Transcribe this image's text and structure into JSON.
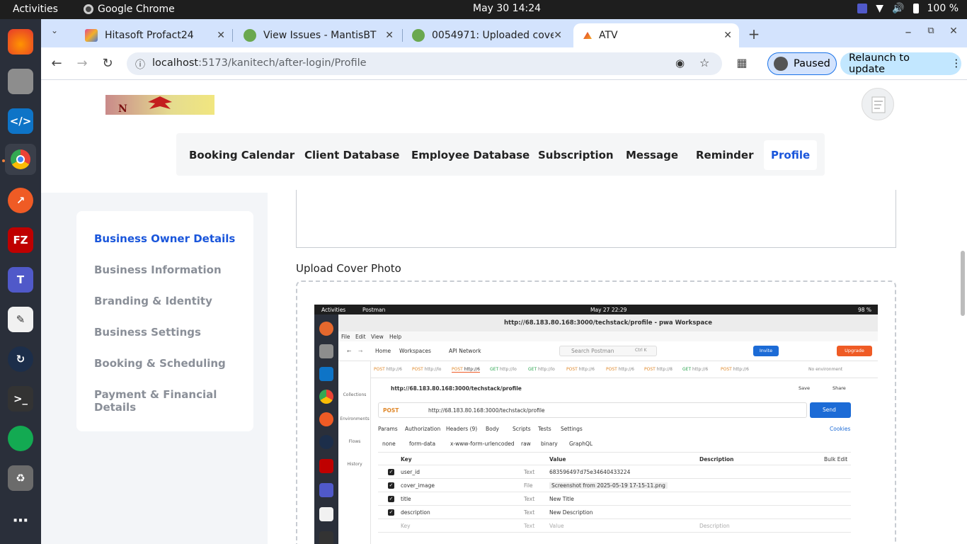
{
  "system_bar": {
    "activities": "Activities",
    "app_name": "Google Chrome",
    "clock": "May 30  14:24",
    "battery": "100 %"
  },
  "tabs": [
    {
      "title": "Hitasoft Profact24"
    },
    {
      "title": "View Issues - MantisBT"
    },
    {
      "title": "0054971: Uploaded cove"
    },
    {
      "title": "ATV"
    }
  ],
  "address_bar": {
    "host": "localhost",
    "path": ":5173/kanitech/after-login/Profile"
  },
  "profile_chip": "Paused",
  "relaunch_label": "Relaunch to update",
  "nav": {
    "items": [
      "Booking Calendar",
      "Client Database",
      "Employee Database",
      "Subscription",
      "Message",
      "Reminder",
      "Profile"
    ],
    "active": "Profile"
  },
  "sidebar": {
    "items": [
      "Business Owner Details",
      "Business Information",
      "Branding & Identity",
      "Business Settings",
      "Booking & Scheduling",
      "Payment & Financial Details"
    ],
    "active": "Business Owner Details"
  },
  "upload_label": "Upload Cover Photo",
  "preview": {
    "activities": "Activities",
    "app": "Postman",
    "clock": "May 27  22:29",
    "battery": "98 %",
    "window_title": "http://68.183.80.168:3000/techstack/profile - pwa Workspace",
    "menu": [
      "File",
      "Edit",
      "View",
      "Help"
    ],
    "home": "Home",
    "workspaces": "Workspaces",
    "api_network": "API Network",
    "search_placeholder": "Search Postman",
    "search_shortcut": "Ctrl K",
    "invite": "Invite",
    "upgrade": "Upgrade",
    "request_tabs": [
      {
        "method": "POST",
        "label": "http://6"
      },
      {
        "method": "POST",
        "label": "http://lo"
      },
      {
        "method": "POST",
        "label": "http://6"
      },
      {
        "method": "GET",
        "label": "http://lo"
      },
      {
        "method": "GET",
        "label": "http://lo"
      },
      {
        "method": "POST",
        "label": "http://6"
      },
      {
        "method": "POST",
        "label": "http://6"
      },
      {
        "method": "POST",
        "label": "http://8"
      },
      {
        "method": "GET",
        "label": "http://6"
      },
      {
        "method": "POST",
        "label": "http://6"
      }
    ],
    "no_environment": "No environment",
    "side_items": [
      "Collections",
      "Environments",
      "Flows",
      "History"
    ],
    "request_name": "http://68.183.80.168:3000/techstack/profile",
    "save": "Save",
    "share": "Share",
    "method": "POST",
    "url": "http://68.183.80.168:3000/techstack/profile",
    "send": "Send",
    "req_tabs": [
      "Params",
      "Authorization",
      "Headers (9)",
      "Body",
      "Scripts",
      "Tests",
      "Settings"
    ],
    "cookies": "Cookies",
    "body_types": [
      "none",
      "form-data",
      "x-www-form-urlencoded",
      "raw",
      "binary",
      "GraphQL"
    ],
    "columns": [
      "Key",
      "Value",
      "Description"
    ],
    "bulk_edit": "Bulk Edit",
    "rows": [
      {
        "key": "user_id",
        "type": "Text",
        "value": "683596497d75e34640433224"
      },
      {
        "key": "cover_image",
        "type": "File",
        "value": "Screenshot from 2025-05-19 17-15-11.png"
      },
      {
        "key": "title",
        "type": "Text",
        "value": "New Title"
      },
      {
        "key": "description",
        "type": "Text",
        "value": "New Description"
      }
    ],
    "empty_row": {
      "key": "Key",
      "type": "Text",
      "value": "Value",
      "description": "Description"
    }
  }
}
